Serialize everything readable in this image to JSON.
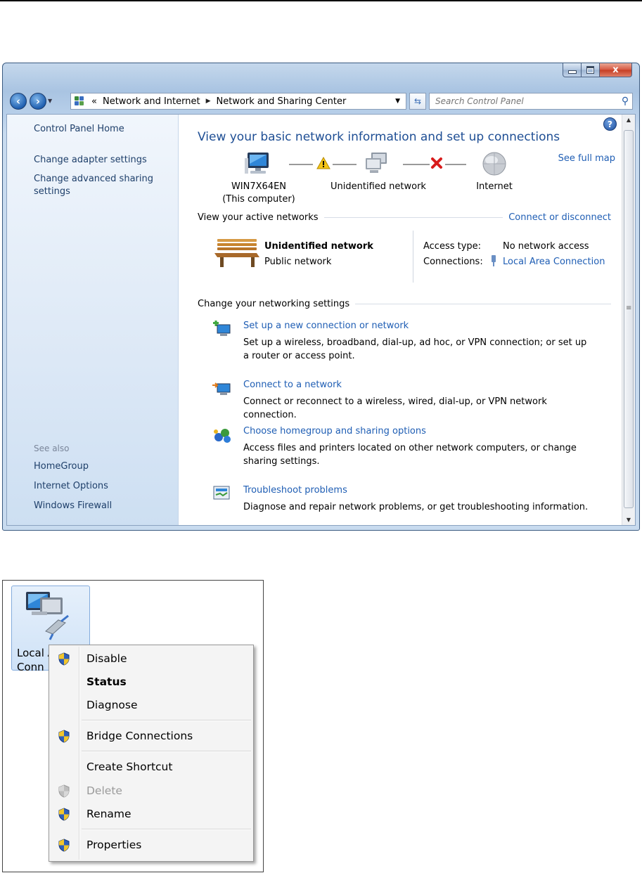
{
  "window": {
    "minimize_label": "–",
    "maximize_label": "□",
    "close_label": "x",
    "back_label": "‹",
    "forward_label": "›",
    "breadcrumb_prefix": "«",
    "breadcrumbs": [
      "Network and Internet",
      "Network and Sharing Center"
    ],
    "search_placeholder": "Search Control Panel"
  },
  "sidebar": {
    "home": "Control Panel Home",
    "change_adapter": "Change adapter settings",
    "change_advanced_1": "Change advanced sharing",
    "change_advanced_2": "settings",
    "see_also": "See also",
    "see_also_links": [
      "HomeGroup",
      "Internet Options",
      "Windows Firewall"
    ]
  },
  "main": {
    "heading": "View your basic network information and set up connections",
    "see_full_map": "See full map",
    "map": {
      "computer_name": "WIN7X64EN",
      "computer_sub": "(This computer)",
      "network": "Unidentified network",
      "internet": "Internet"
    },
    "active_networks_label": "View your active networks",
    "connect_disconnect": "Connect or disconnect",
    "network_name": "Unidentified network",
    "network_type": "Public network",
    "access_type_label": "Access type:",
    "access_type_value": "No network access",
    "connections_label": "Connections:",
    "connections_value": "Local Area Connection",
    "change_settings_label": "Change your networking settings",
    "tasks": [
      {
        "title": "Set up a new connection or network",
        "desc": "Set up a wireless, broadband, dial-up, ad hoc, or VPN connection; or set up a router or access point."
      },
      {
        "title": "Connect to a network",
        "desc": "Connect or reconnect to a wireless, wired, dial-up, or VPN network connection."
      },
      {
        "title": "Choose homegroup and sharing options",
        "desc": "Access files and printers located on other network computers, or change sharing settings."
      },
      {
        "title": "Troubleshoot problems",
        "desc": "Diagnose and repair network problems, or get troubleshooting information."
      }
    ]
  },
  "context": {
    "icon_label_1": "Local A",
    "icon_label_2": "Conn",
    "menu": [
      "Disable",
      "Status",
      "Diagnose",
      "Bridge Connections",
      "Create Shortcut",
      "Delete",
      "Rename",
      "Properties"
    ]
  },
  "colors": {
    "link": "#1f5eb4",
    "heading": "#1e4e94",
    "shield_blue": "#2f5fb8",
    "shield_yellow": "#f2c52c"
  }
}
